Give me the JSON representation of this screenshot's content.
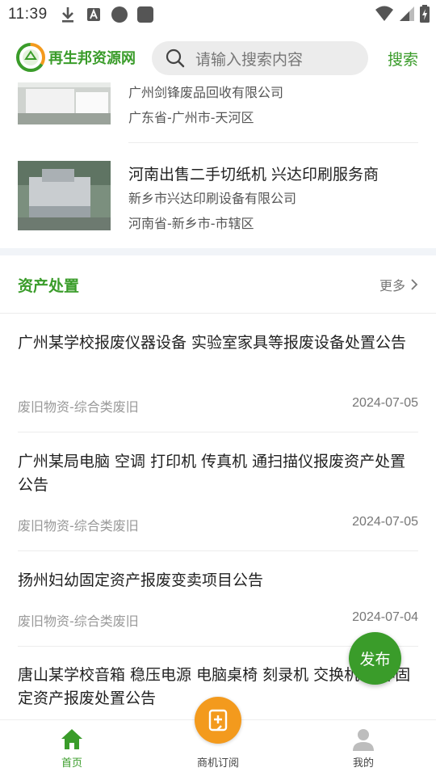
{
  "status_bar": {
    "time": "11:39",
    "icons": [
      "download-icon",
      "text-icon",
      "circle-icon",
      "square-icon"
    ],
    "right_icons": [
      "wifi-icon",
      "signal-icon",
      "battery-icon"
    ]
  },
  "header": {
    "logo_text": "再生邦资源网",
    "search_placeholder": "请输入搜索内容",
    "search_button": "搜索"
  },
  "products": [
    {
      "title": "",
      "company": "广州剑锋废品回收有限公司",
      "region": "广东省-广州市-天河区"
    },
    {
      "title": "河南出售二手切纸机 兴达印刷服务商",
      "company": "新乡市兴达印刷设备有限公司",
      "region": "河南省-新乡市-市辖区"
    }
  ],
  "asset_section": {
    "title": "资产处置",
    "more": "更多",
    "notices": [
      {
        "title": "广州某学校报废仪器设备 实验室家具等报废设备处置公告",
        "category": "废旧物资-综合类废旧",
        "date": "2024-07-05"
      },
      {
        "title": "广州某局电脑 空调 打印机 传真机 通扫描仪报废资产处置公告",
        "category": "废旧物资-综合类废旧",
        "date": "2024-07-05"
      },
      {
        "title": "扬州妇幼固定资产报废变卖项目公告",
        "category": "废旧物资-综合类废旧",
        "date": "2024-07-04"
      },
      {
        "title": "唐山某学校音箱 稳压电源 电脑桌椅 刻录机 交换机 等非固定资产报废处置公告",
        "category": "",
        "date": ""
      }
    ]
  },
  "publish_button": "发布",
  "bottom_nav": {
    "home": "首页",
    "subscribe": "商机订阅",
    "mine": "我的"
  },
  "colors": {
    "brand_green": "#3a9c2a",
    "fab_orange": "#f39a1d"
  }
}
